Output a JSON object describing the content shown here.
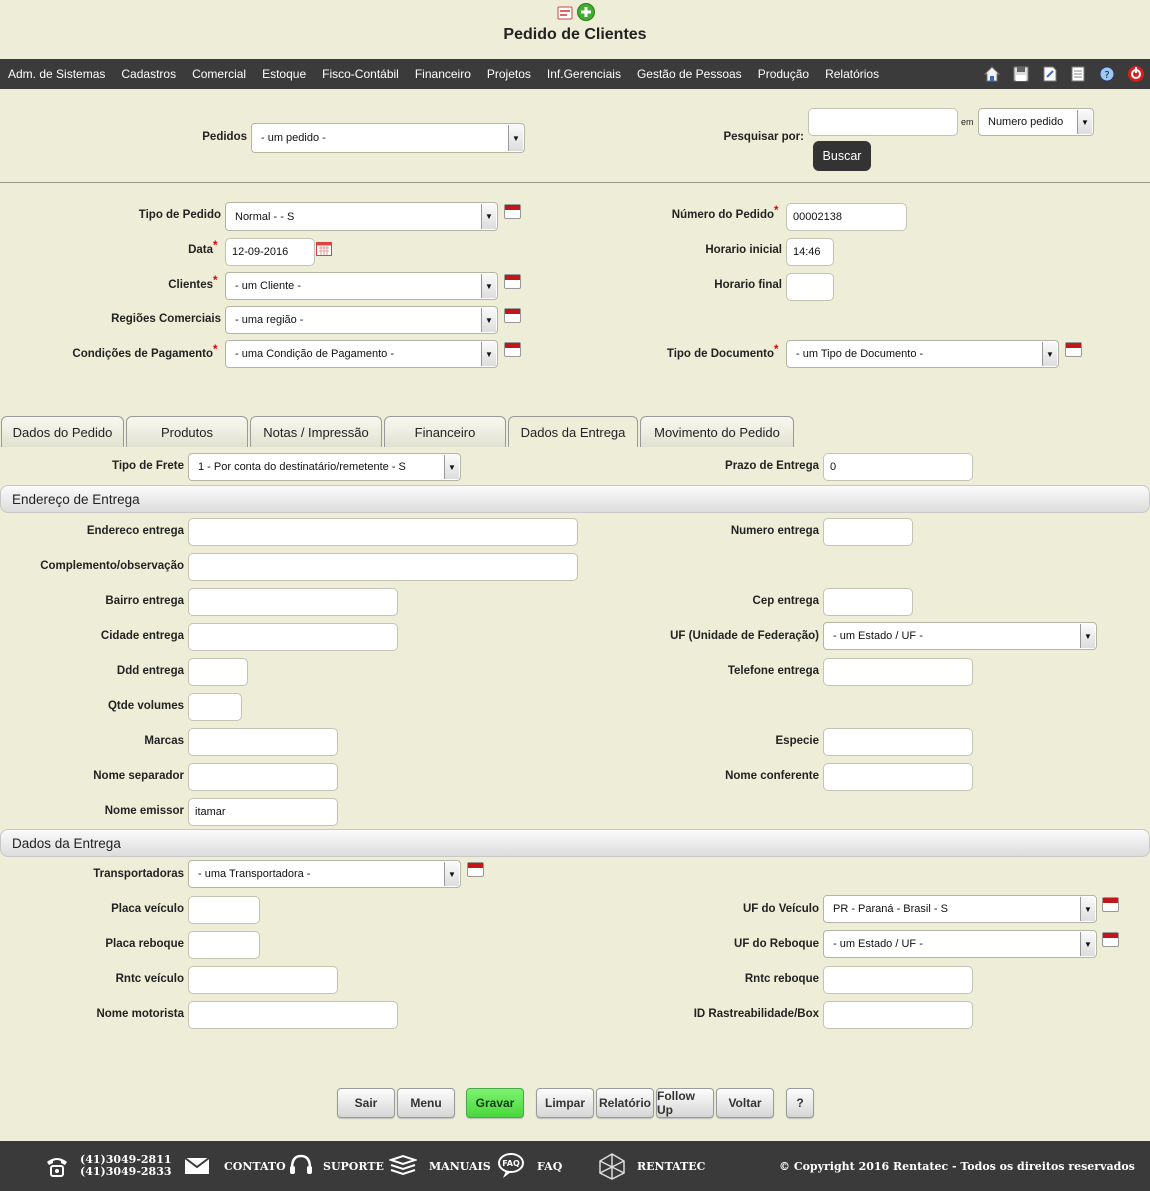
{
  "page": {
    "title": "Pedido de Clientes"
  },
  "menu": [
    "Adm. de Sistemas",
    "Cadastros",
    "Comercial",
    "Estoque",
    "Fisco-Contábil",
    "Financeiro",
    "Projetos",
    "Inf.Gerenciais",
    "Gestão de Pessoas",
    "Produção",
    "Relatórios"
  ],
  "search": {
    "pedidos_label": "Pedidos",
    "pedidos_value": "- um pedido -",
    "pesquisar_label": "Pesquisar por:",
    "em_label": "em",
    "campo_value": "Numero pedido",
    "buscar_label": "Buscar"
  },
  "header_form": {
    "tipo_pedido": {
      "label": "Tipo de Pedido",
      "value": "Normal - - S"
    },
    "data": {
      "label": "Data",
      "value": "12-09-2016"
    },
    "clientes": {
      "label": "Clientes",
      "value": "- um Cliente -"
    },
    "regioes": {
      "label": "Regiões Comerciais",
      "value": "- uma região -"
    },
    "condicoes": {
      "label": "Condições de Pagamento",
      "value": "- uma Condição de Pagamento -"
    },
    "numero_pedido": {
      "label": "Número do Pedido",
      "value": "00002138"
    },
    "horario_inicial": {
      "label": "Horario inicial",
      "value": "14:46"
    },
    "horario_final": {
      "label": "Horario final",
      "value": ""
    },
    "tipo_documento": {
      "label": "Tipo de Documento",
      "value": "- um Tipo de Documento -"
    }
  },
  "tabs": [
    "Dados do Pedido",
    "Produtos",
    "Notas / Impressão",
    "Financeiro",
    "Dados da Entrega",
    "Movimento do Pedido"
  ],
  "entrega": {
    "tipo_frete": {
      "label": "Tipo de Frete",
      "value": "1 - Por conta do destinatário/remetente - S"
    },
    "prazo": {
      "label": "Prazo de Entrega",
      "value": "0"
    },
    "section_endereco": "Endereço de Entrega",
    "endereco": {
      "label": "Endereco entrega",
      "value": ""
    },
    "numero": {
      "label": "Numero entrega",
      "value": ""
    },
    "complemento": {
      "label": "Complemento/observação",
      "value": ""
    },
    "bairro": {
      "label": "Bairro entrega",
      "value": ""
    },
    "cep": {
      "label": "Cep entrega",
      "value": ""
    },
    "cidade": {
      "label": "Cidade entrega",
      "value": ""
    },
    "uf": {
      "label": "UF (Unidade de Federação)",
      "value": "- um Estado / UF -"
    },
    "ddd": {
      "label": "Ddd entrega",
      "value": ""
    },
    "telefone": {
      "label": "Telefone entrega",
      "value": ""
    },
    "qtde_volumes": {
      "label": "Qtde volumes",
      "value": ""
    },
    "marcas": {
      "label": "Marcas",
      "value": ""
    },
    "especie": {
      "label": "Especie",
      "value": ""
    },
    "nome_separador": {
      "label": "Nome separador",
      "value": ""
    },
    "nome_conferente": {
      "label": "Nome conferente",
      "value": ""
    },
    "nome_emissor": {
      "label": "Nome emissor",
      "value": "itamar"
    },
    "section_dados": "Dados da Entrega",
    "transportadoras": {
      "label": "Transportadoras",
      "value": "- uma Transportadora -"
    },
    "placa_veiculo": {
      "label": "Placa veículo",
      "value": ""
    },
    "uf_veiculo": {
      "label": "UF do Veículo",
      "value": "PR - Paraná - Brasil - S"
    },
    "placa_reboque": {
      "label": "Placa reboque",
      "value": ""
    },
    "uf_reboque": {
      "label": "UF do Reboque",
      "value": "- um Estado / UF -"
    },
    "rntc_veiculo": {
      "label": "Rntc veículo",
      "value": ""
    },
    "rntc_reboque": {
      "label": "Rntc reboque",
      "value": ""
    },
    "nome_motorista": {
      "label": "Nome motorista",
      "value": ""
    },
    "id_rastreabilidade": {
      "label": "ID Rastreabilidade/Box",
      "value": ""
    }
  },
  "buttons": [
    "Sair",
    "Menu",
    "Gravar",
    "Limpar",
    "Relatório",
    "Follow Up",
    "Voltar",
    "?"
  ],
  "footer": {
    "phone1": "(41)3049-2811",
    "phone2": "(41)3049-2833",
    "contato": "CONTATO",
    "suporte": "SUPORTE",
    "manuais": "MANUAIS",
    "faq": "FAQ",
    "rentatec": "RENTATEC",
    "copyright": "© Copyright 2016 Rentatec - Todos os direitos reservados"
  }
}
